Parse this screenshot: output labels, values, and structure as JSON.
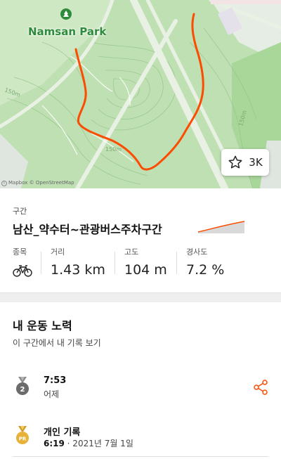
{
  "map": {
    "park_label": "Namsan Park",
    "contours": [
      "150m",
      "150m",
      "150m"
    ],
    "attribution": "Mapbox © OpenStreetMap",
    "favorite_count": "3K",
    "route_color": "#fc4c02"
  },
  "segment": {
    "caption": "구간",
    "name": "남산_약수터~관광버스주차구간",
    "stats": [
      {
        "label": "종목",
        "value": "",
        "icon": "bicycle-icon"
      },
      {
        "label": "거리",
        "value": "1.43 km"
      },
      {
        "label": "고도",
        "value": "104 m"
      },
      {
        "label": "경사도",
        "value": "7.2 %"
      }
    ]
  },
  "efforts": {
    "title": "내 운동 노력",
    "subtitle": "이 구간에서 내 기록 보기",
    "items": [
      {
        "medal": "2",
        "medal_icon": "silver-medal-icon",
        "time": "7:53",
        "date": "어제"
      },
      {
        "medal": "PR",
        "medal_icon": "gold-pr-medal-icon",
        "label": "개인 기록",
        "time": "6:19",
        "date": " · 2021년 7월 1일"
      }
    ]
  },
  "colors": {
    "accent": "#fc4c02",
    "map_park": "#bfe0b2",
    "medal_gold": "#e8b23a",
    "medal_silver": "#6b6b6b"
  }
}
